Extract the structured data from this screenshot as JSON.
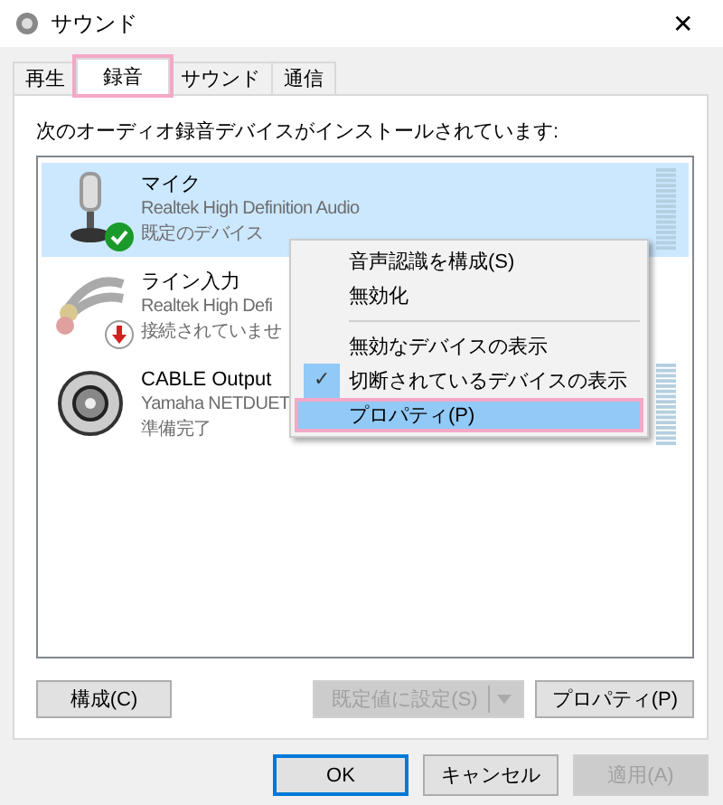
{
  "window": {
    "title": "サウンド",
    "close": "✕"
  },
  "tabs": [
    {
      "label": "再生",
      "selected": false,
      "highlighted": false
    },
    {
      "label": "録音",
      "selected": true,
      "highlighted": true
    },
    {
      "label": "サウンド",
      "selected": false,
      "highlighted": false
    },
    {
      "label": "通信",
      "selected": false,
      "highlighted": false
    }
  ],
  "instruction": "次のオーディオ録音デバイスがインストールされています:",
  "devices": [
    {
      "kind": "microphone",
      "badge": {
        "kind": "default"
      },
      "name": "マイク",
      "driver": "Realtek High Definition Audio",
      "status": "既定のデバイス",
      "selected": true,
      "meter": true
    },
    {
      "kind": "line-in",
      "badge": {
        "kind": "unplugged"
      },
      "name": "ライン入力",
      "driver": "Realtek High Defi",
      "status": "接続されていませ",
      "selected": false,
      "meter": false
    },
    {
      "kind": "cable",
      "name": "CABLE Output",
      "driver": "Yamaha NETDUET",
      "status": "準備完了",
      "selected": false,
      "meter": true
    }
  ],
  "context_menu": [
    {
      "kind": "item",
      "label": "音声認識を構成(S)",
      "checked": false,
      "selected": false,
      "highlighted": false
    },
    {
      "kind": "item",
      "label": "無効化",
      "checked": false,
      "selected": false,
      "highlighted": false
    },
    {
      "kind": "separator"
    },
    {
      "kind": "item",
      "label": "無効なデバイスの表示",
      "checked": false,
      "selected": false,
      "highlighted": false
    },
    {
      "kind": "item",
      "label": "切断されているデバイスの表示",
      "checked": true,
      "selected": false,
      "highlighted": false
    },
    {
      "kind": "item",
      "label": "プロパティ(P)",
      "checked": false,
      "selected": true,
      "highlighted": true
    }
  ],
  "check_mark": "✓",
  "panel_buttons": {
    "configure": {
      "label": "構成(C)",
      "disabled": false
    },
    "set_default": {
      "label": "既定値に設定(S)",
      "disabled": true
    },
    "properties": {
      "label": "プロパティ(P)",
      "disabled": false
    }
  },
  "dialog_buttons": [
    {
      "label": "OK",
      "default": true,
      "disabled": false
    },
    {
      "label": "キャンセル",
      "default": false,
      "disabled": false
    },
    {
      "label": "適用(A)",
      "default": false,
      "disabled": true
    }
  ]
}
